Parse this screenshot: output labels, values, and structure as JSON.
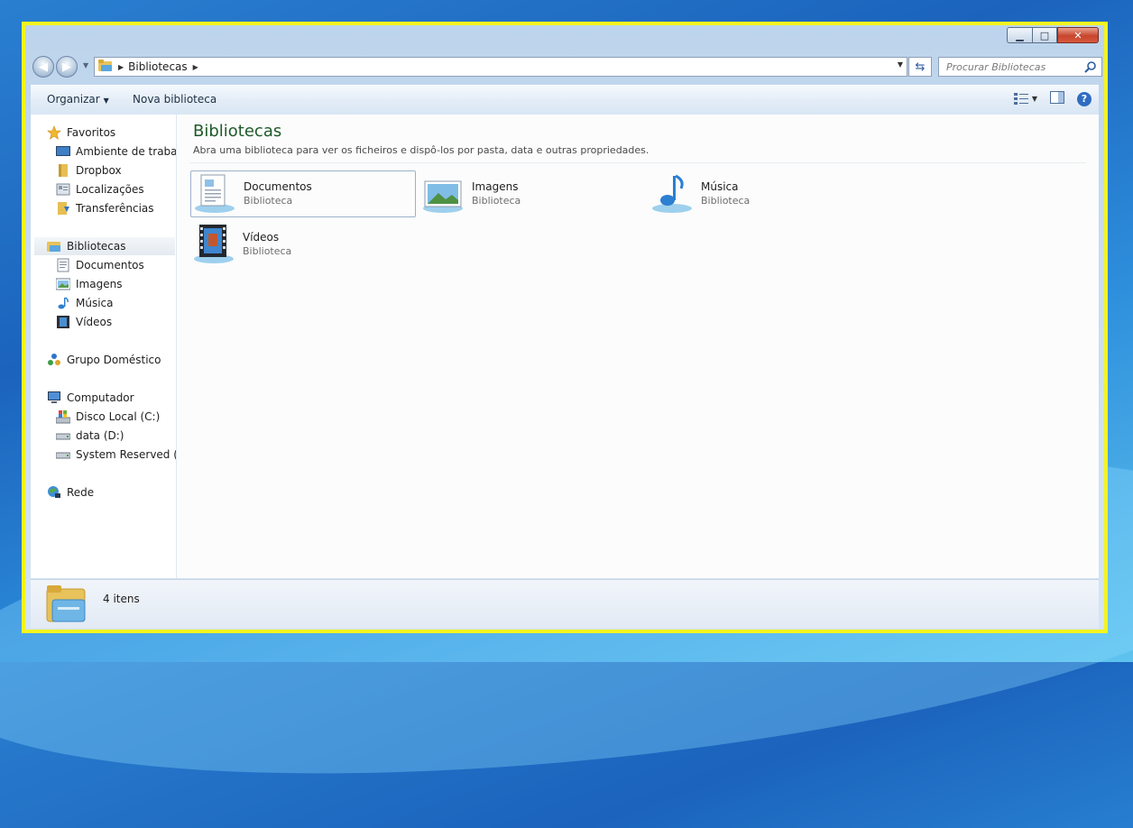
{
  "window": {
    "title_buttons": [
      "minimize",
      "maximize",
      "close"
    ]
  },
  "address_bar": {
    "crumbs": [
      "Bibliotecas"
    ],
    "search_placeholder": "Procurar Bibliotecas"
  },
  "toolbar": {
    "organize_label": "Organizar",
    "new_library_label": "Nova biblioteca"
  },
  "sidebar": {
    "favorites": {
      "label": "Favoritos",
      "items": [
        {
          "label": "Ambiente de trabalho",
          "icon": "desktop-icon"
        },
        {
          "label": "Dropbox",
          "icon": "dropbox-folder-icon"
        },
        {
          "label": "Localizações",
          "icon": "places-icon"
        },
        {
          "label": "Transferências",
          "icon": "downloads-icon"
        }
      ]
    },
    "libraries": {
      "label": "Bibliotecas",
      "items": [
        {
          "label": "Documentos",
          "icon": "documents-icon"
        },
        {
          "label": "Imagens",
          "icon": "pictures-icon"
        },
        {
          "label": "Música",
          "icon": "music-icon"
        },
        {
          "label": "Vídeos",
          "icon": "videos-icon"
        }
      ]
    },
    "homegroup": {
      "label": "Grupo Doméstico"
    },
    "computer": {
      "label": "Computador",
      "items": [
        {
          "label": "Disco Local (C:)",
          "icon": "system-drive-icon"
        },
        {
          "label": "data (D:)",
          "icon": "drive-icon"
        },
        {
          "label": "System Reserved (F:)",
          "icon": "drive-icon"
        }
      ]
    },
    "network": {
      "label": "Rede"
    }
  },
  "content": {
    "title": "Bibliotecas",
    "subtitle": "Abra uma biblioteca para ver os ficheiros e dispô-los por pasta, data e outras propriedades.",
    "libraries": [
      {
        "name": "Documentos",
        "type": "Biblioteca",
        "icon": "documents-library-icon"
      },
      {
        "name": "Imagens",
        "type": "Biblioteca",
        "icon": "pictures-library-icon"
      },
      {
        "name": "Música",
        "type": "Biblioteca",
        "icon": "music-library-icon"
      },
      {
        "name": "Vídeos",
        "type": "Biblioteca",
        "icon": "videos-library-icon"
      }
    ]
  },
  "status_bar": {
    "item_count": "4 itens"
  },
  "colors": {
    "frame_highlight": "#f4f41e",
    "title_green": "#1e5a28",
    "desktop_blue": "#1b63bd"
  }
}
